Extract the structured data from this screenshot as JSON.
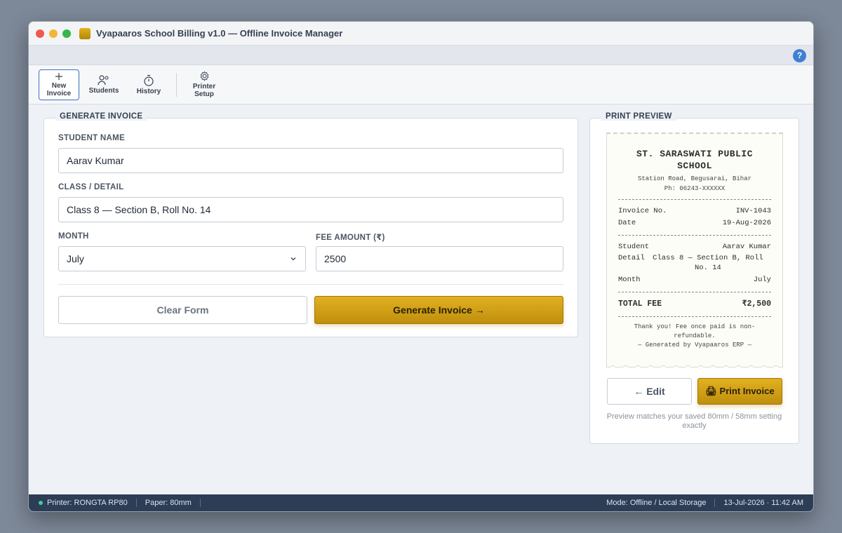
{
  "window": {
    "title": "Vyapaaros School Billing v1.0 — Offline Invoice Manager"
  },
  "help": {
    "label": "?"
  },
  "toolbar": {
    "items": [
      {
        "label": "New Invoice",
        "icon": "plus-icon"
      },
      {
        "label": "Students",
        "icon": "users-icon"
      },
      {
        "label": "History",
        "icon": "stopwatch-icon"
      },
      {
        "label": "Printer Setup",
        "icon": "gear-icon"
      }
    ]
  },
  "form": {
    "legend": "GENERATE INVOICE",
    "student_name": {
      "label": "STUDENT NAME",
      "value": "Aarav Kumar"
    },
    "class_detail": {
      "label": "CLASS / DETAIL",
      "value": "Class 8 — Section B, Roll No. 14"
    },
    "month": {
      "label": "MONTH",
      "value": "July"
    },
    "fee_amount": {
      "label": "FEE AMOUNT (₹)",
      "value": "2500"
    },
    "clear_label": "Clear Form",
    "generate_label": "Generate Invoice →"
  },
  "preview": {
    "legend": "PRINT PREVIEW",
    "school_name": "ST. SARASWATI PUBLIC SCHOOL",
    "address": "Station Road, Begusarai, Bihar",
    "phone": "Ph: 06243-XXXXXX",
    "invoice_no_label": "Invoice No.",
    "invoice_no": "INV-1043",
    "date_label": "Date",
    "date": "19-Aug-2026",
    "student_label": "Student",
    "student": "Aarav Kumar",
    "detail_label": "Detail",
    "detail": "Class 8 — Section B, Roll No. 14",
    "month_label": "Month",
    "month": "July",
    "total_label": "TOTAL FEE",
    "total": "₹2,500",
    "thanks": "Thank you! Fee once paid is non-refundable.",
    "generated_by": "— Generated by Vyapaaros ERP —",
    "edit_label": "← Edit",
    "print_label": "🖨 Print Invoice",
    "note": "Preview matches your saved 80mm / 58mm setting exactly"
  },
  "status": {
    "printer_label": "Printer:",
    "printer": "RONGTA RP80",
    "paper_label": "Paper:",
    "paper": "80mm",
    "mode": "Mode: Offline / Local Storage",
    "datetime": "13-Jul-2026 · 11:42 AM"
  },
  "colors": {
    "accent": "#c99a12",
    "status_bar": "#2c3d55",
    "online": "#34d399"
  }
}
